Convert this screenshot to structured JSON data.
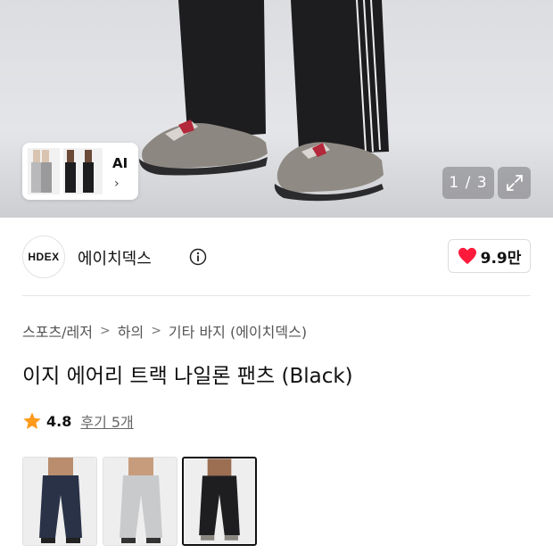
{
  "gallery": {
    "counter": "1 / 3",
    "ai_thumb": {
      "label": "AI",
      "arrow": "›"
    },
    "icons": {
      "expand": "expand-icon"
    }
  },
  "brand": {
    "logo_text": "HDEX",
    "name": "에이치덱스",
    "icons": {
      "info": "info-icon"
    }
  },
  "like": {
    "count": "9.9만",
    "heart_color": "#ff1a3c"
  },
  "breadcrumb": [
    "스포츠/레저",
    "하의",
    "기타 바지 (에이치덱스)"
  ],
  "breadcrumb_separator": ">",
  "product": {
    "title": "이지 에어리 트랙 나일론 팬츠 (Black)",
    "rating": "4.8",
    "reviews": "후기 5개",
    "star_color": "#ff9a1a"
  },
  "variants": [
    {
      "color_name": "navy",
      "pants_color": "#2a3247",
      "selected": false
    },
    {
      "color_name": "gray",
      "pants_color": "#c9cacc",
      "selected": false
    },
    {
      "color_name": "black",
      "pants_color": "#1e1e20",
      "selected": true
    }
  ]
}
